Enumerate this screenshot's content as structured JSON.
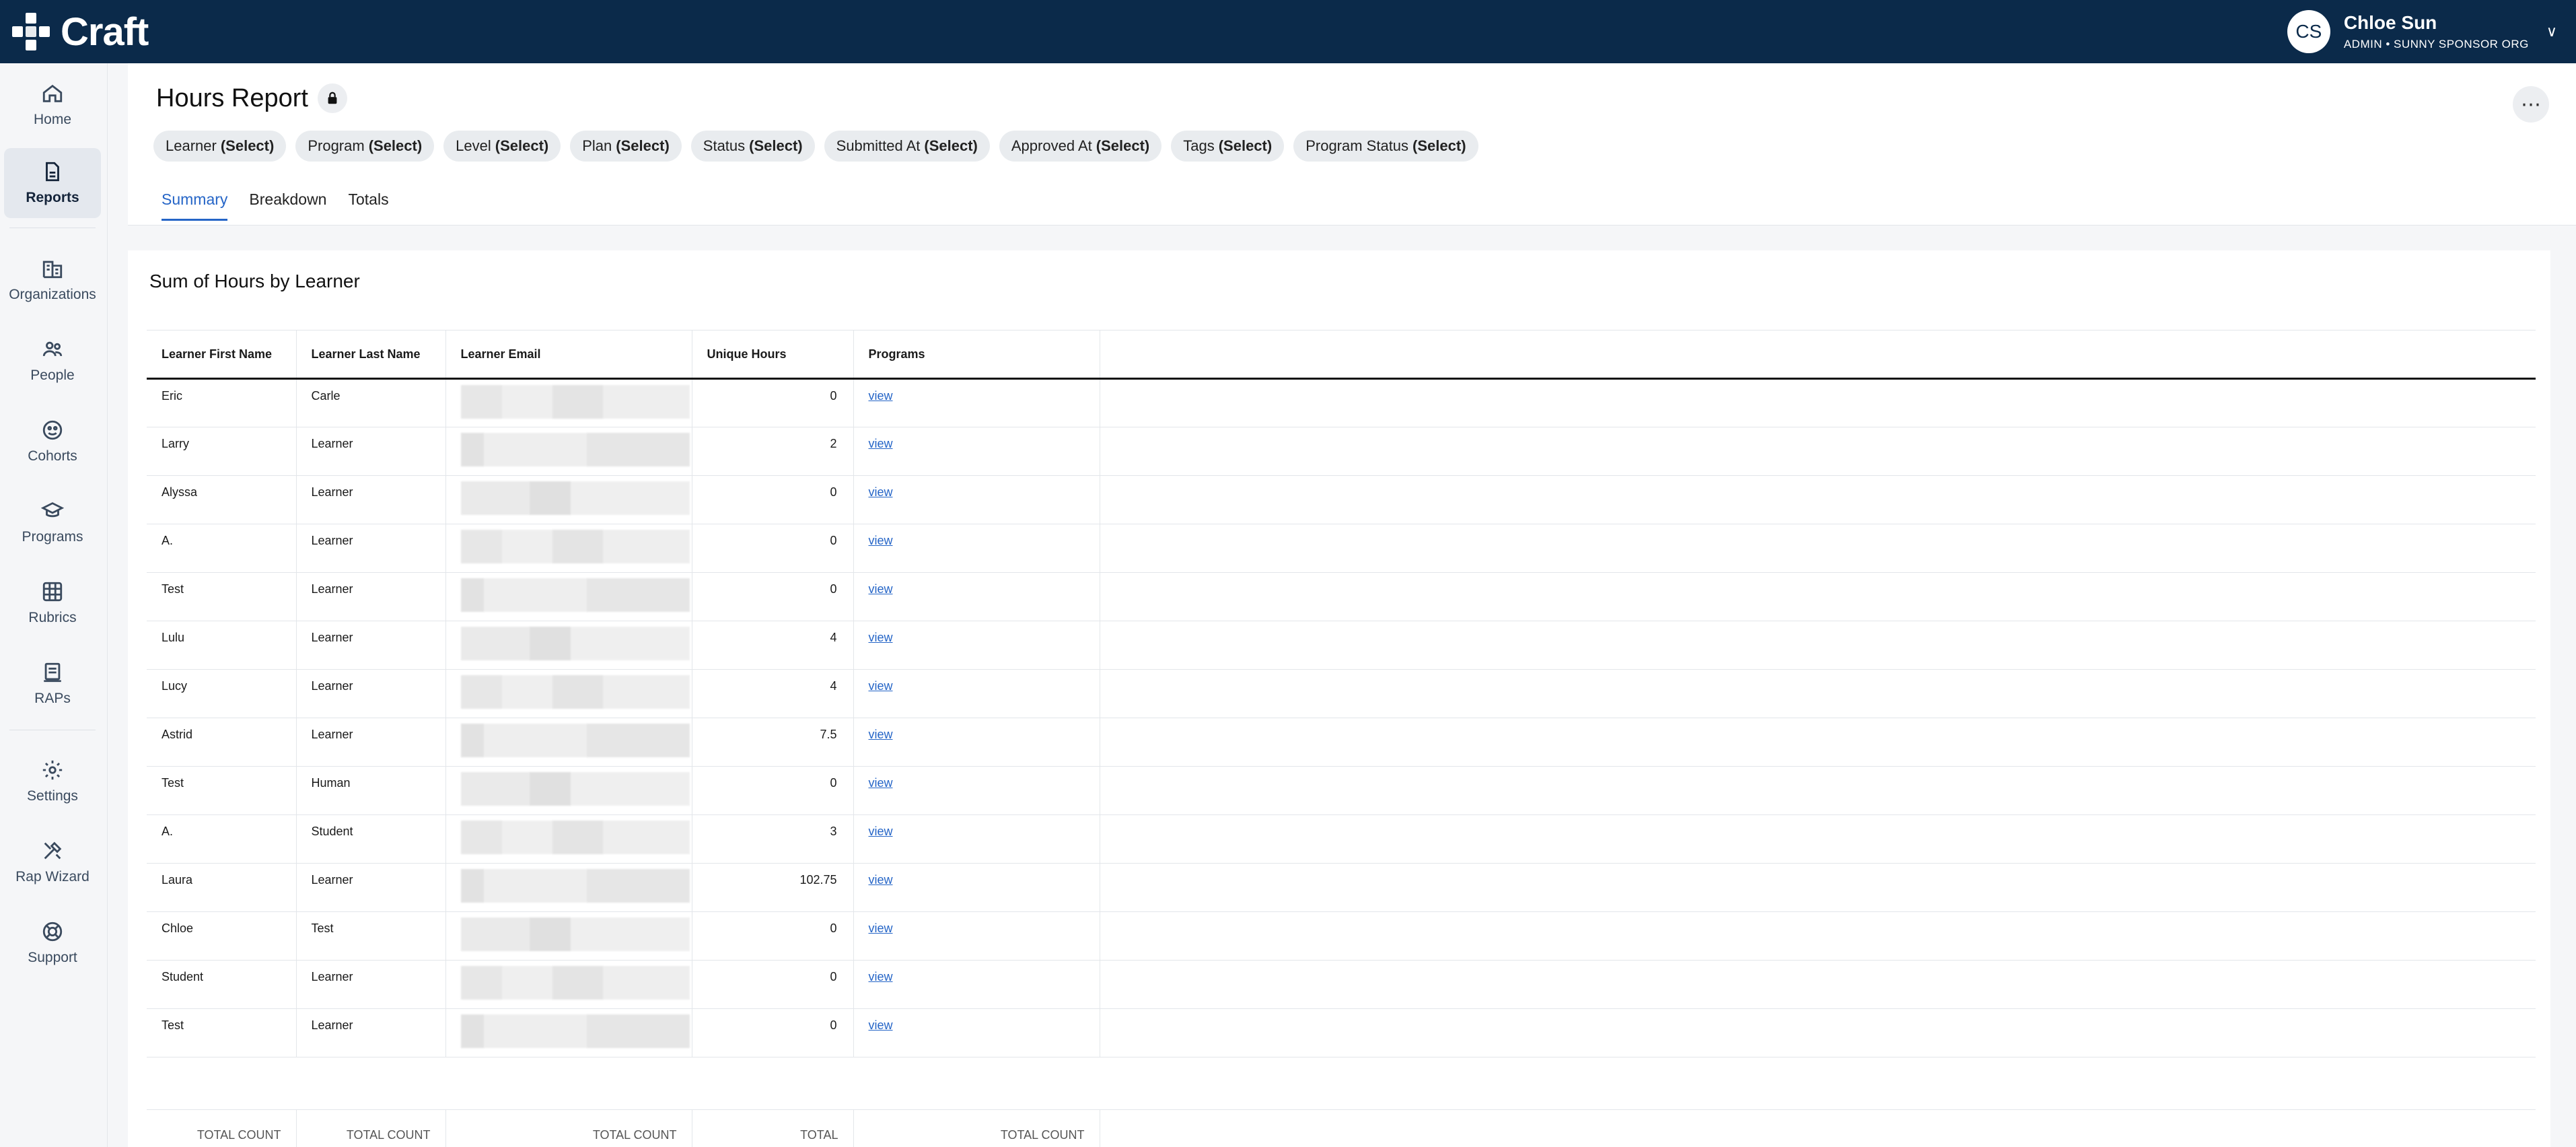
{
  "app": {
    "logo_text": "Craft",
    "user": {
      "initials": "CS",
      "name": "Chloe Sun",
      "role": "ADMIN • SUNNY SPONSOR ORG"
    }
  },
  "sidebar": {
    "items": [
      {
        "label": "Home",
        "icon": "home-icon"
      },
      {
        "label": "Reports",
        "icon": "report-icon",
        "active": true
      },
      {
        "label": "Organizations",
        "icon": "building-icon"
      },
      {
        "label": "People",
        "icon": "people-icon"
      },
      {
        "label": "Cohorts",
        "icon": "cohort-icon"
      },
      {
        "label": "Programs",
        "icon": "graduation-cap-icon"
      },
      {
        "label": "Rubrics",
        "icon": "grid-icon"
      },
      {
        "label": "RAPs",
        "icon": "document-icon"
      },
      {
        "label": "Settings",
        "icon": "gear-icon"
      },
      {
        "label": "Rap Wizard",
        "icon": "tools-icon"
      },
      {
        "label": "Support",
        "icon": "lifebuoy-icon"
      }
    ]
  },
  "header": {
    "title": "Hours Report",
    "filters": [
      {
        "label": "Learner",
        "value": "(Select)"
      },
      {
        "label": "Program",
        "value": "(Select)"
      },
      {
        "label": "Level",
        "value": "(Select)"
      },
      {
        "label": "Plan",
        "value": "(Select)"
      },
      {
        "label": "Status",
        "value": "(Select)"
      },
      {
        "label": "Submitted At",
        "value": "(Select)"
      },
      {
        "label": "Approved At",
        "value": "(Select)"
      },
      {
        "label": "Tags",
        "value": "(Select)"
      },
      {
        "label": "Program Status",
        "value": "(Select)"
      }
    ],
    "tabs": [
      {
        "label": "Summary",
        "active": true
      },
      {
        "label": "Breakdown"
      },
      {
        "label": "Totals"
      }
    ]
  },
  "report": {
    "title": "Sum of Hours by Learner",
    "columns": [
      "Learner First Name",
      "Learner Last Name",
      "Learner Email",
      "Unique Hours",
      "Programs"
    ],
    "rows": [
      {
        "first": "Eric",
        "last": "Carle",
        "hours": "0",
        "programs": "view"
      },
      {
        "first": "Larry",
        "last": "Learner",
        "hours": "2",
        "programs": "view"
      },
      {
        "first": "Alyssa",
        "last": "Learner",
        "hours": "0",
        "programs": "view"
      },
      {
        "first": "A.",
        "last": "Learner",
        "hours": "0",
        "programs": "view"
      },
      {
        "first": "Test",
        "last": "Learner",
        "hours": "0",
        "programs": "view"
      },
      {
        "first": "Lulu",
        "last": "Learner",
        "hours": "4",
        "programs": "view"
      },
      {
        "first": "Lucy",
        "last": "Learner",
        "hours": "4",
        "programs": "view"
      },
      {
        "first": "Astrid",
        "last": "Learner",
        "hours": "7.5",
        "programs": "view"
      },
      {
        "first": "Test",
        "last": "Human",
        "hours": "0",
        "programs": "view"
      },
      {
        "first": "A.",
        "last": "Student",
        "hours": "3",
        "programs": "view"
      },
      {
        "first": "Laura",
        "last": "Learner",
        "hours": "102.75",
        "programs": "view"
      },
      {
        "first": "Chloe",
        "last": "Test",
        "hours": "0",
        "programs": "view"
      },
      {
        "first": "Student",
        "last": "Learner",
        "hours": "0",
        "programs": "view"
      },
      {
        "first": "Test",
        "last": "Learner",
        "hours": "0",
        "programs": "view"
      }
    ],
    "footer": [
      "TOTAL COUNT",
      "TOTAL COUNT",
      "TOTAL COUNT",
      "TOTAL",
      "TOTAL COUNT"
    ]
  }
}
